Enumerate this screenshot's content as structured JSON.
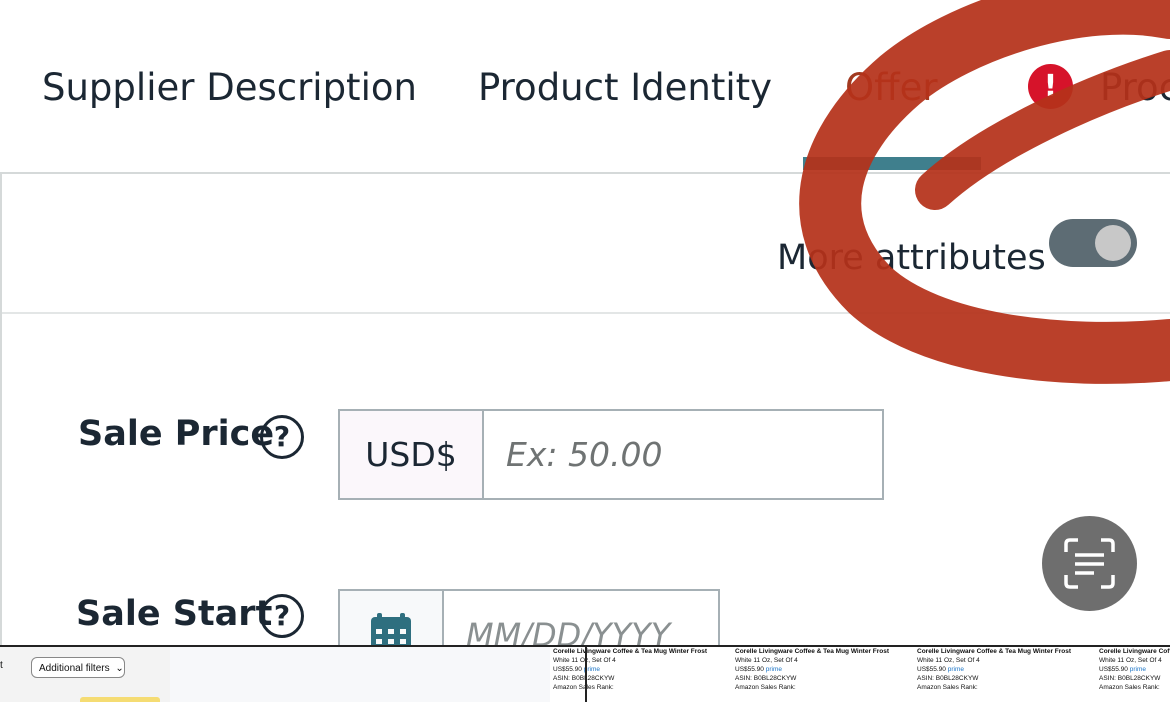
{
  "tabs": {
    "supplier_description": "Supplier Description",
    "product_identity": "Product Identity",
    "offer": "Offer",
    "alert_glyph": "!",
    "product_truncated": "Proc",
    "active": "Offer"
  },
  "attributes": {
    "more_attributes_label": "More attributes",
    "toggle_on": false
  },
  "sale_price": {
    "label": "Sale Price",
    "help_glyph": "?",
    "currency": "USD$",
    "placeholder": "Ex: 50.00"
  },
  "sale_start": {
    "label": "Sale Start",
    "help_glyph": "?",
    "placeholder": "MM/DD/YYYY"
  },
  "icons": {
    "help": "help-circle-icon",
    "calendar": "calendar-icon",
    "scan": "scan-text-icon",
    "alert": "exclamation-circle-icon"
  },
  "colors": {
    "tab_underline": "#3f7f8d",
    "alert": "#d6132a",
    "annotation_stroke": "#b5321a"
  },
  "bottom_strip": {
    "filters_label": "Additional filters",
    "left_char": "t",
    "products": [
      {
        "title": "Corelle Livingware Coffee & Tea Mug Winter Frost",
        "subtitle": "White 11 Oz, Set Of 4",
        "price": "US$55.90",
        "prime": "prime",
        "asin": "ASIN: B0BL28CKYW",
        "rank": "Amazon Sales Rank:"
      },
      {
        "title": "Corelle Livingware Coffee & Tea Mug Winter Frost",
        "subtitle": "White 11 Oz, Set Of 4",
        "price": "US$55.90",
        "prime": "prime",
        "asin": "ASIN: B0BL28CKYW",
        "rank": "Amazon Sales Rank:"
      },
      {
        "title": "Corelle Livingware Coffee & Tea Mug Winter Frost",
        "subtitle": "White 11 Oz, Set Of 4",
        "price": "US$55.90",
        "prime": "prime",
        "asin": "ASIN: B0BL28CKYW",
        "rank": "Amazon Sales Rank:"
      },
      {
        "title": "Corelle Livingware Coffee & Tea Mug Winter Frost",
        "subtitle": "White 11 Oz, Set Of 4",
        "price": "US$55.90",
        "prime": "prime",
        "asin": "ASIN: B0BL28CKYW",
        "rank": "Amazon Sales Rank:"
      }
    ]
  }
}
